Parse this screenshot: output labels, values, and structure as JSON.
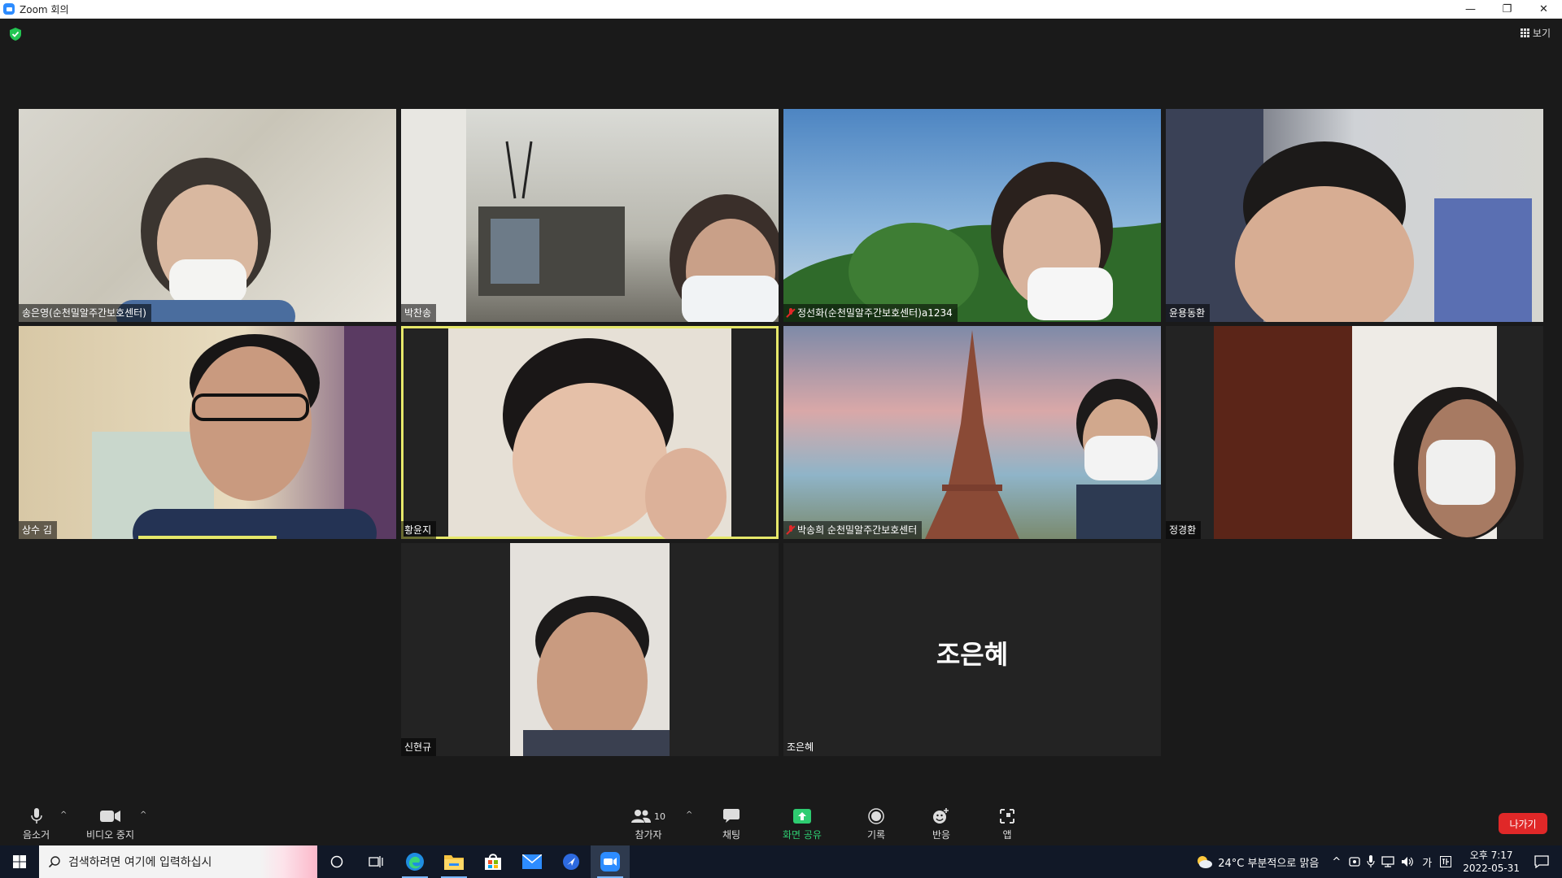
{
  "window": {
    "title": "Zoom 회의",
    "controls": [
      "—",
      "❐",
      "✕"
    ]
  },
  "topbar": {
    "view_label": "보기"
  },
  "participants": [
    {
      "name": "송은영(순천밀알주간보호센터)",
      "muted": false
    },
    {
      "name": "박찬송",
      "muted": false
    },
    {
      "name": "정선화(순천밀알주간보호센터)a1234",
      "muted": true
    },
    {
      "name": "윤용동환",
      "muted": false
    },
    {
      "name": "상수 김",
      "muted": false,
      "speaking": true
    },
    {
      "name": "황윤지",
      "muted": false,
      "active": true
    },
    {
      "name": "박송희 순천밀알주간보호센터",
      "muted": true
    },
    {
      "name": "정경환",
      "muted": false
    },
    {
      "name": "신현규",
      "muted": false
    },
    {
      "name": "조은혜",
      "muted": false,
      "video_off": true,
      "display_name": "조은혜"
    }
  ],
  "controls": {
    "mute": "음소거",
    "video": "비디오 중지",
    "participants": "참가자",
    "participants_count": "10",
    "chat": "채팅",
    "share": "화면 공유",
    "record": "기록",
    "reactions": "반응",
    "apps": "앱",
    "leave": "나가기"
  },
  "taskbar": {
    "search_placeholder": "검색하려면 여기에 입력하십시",
    "weather": "24°C  부분적으로 맑음",
    "ime": "가",
    "time": "오후 7:17",
    "date": "2022-05-31"
  },
  "colors": {
    "accent_green": "#2ecc71",
    "leave_red": "#e02828",
    "active_speaker": "#e6e86a",
    "zoom_blue": "#2d8cff"
  }
}
